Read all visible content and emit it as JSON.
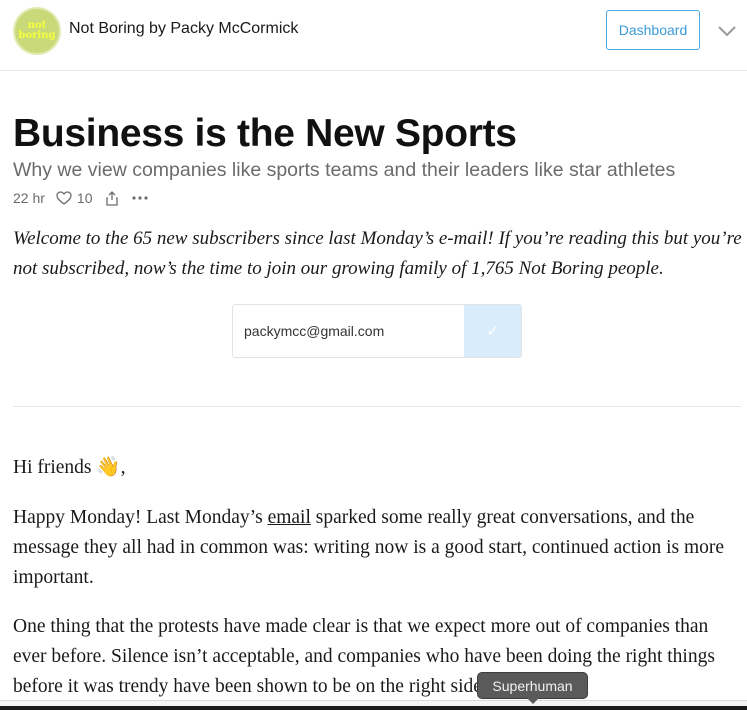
{
  "header": {
    "logo_text": [
      "not",
      "boring"
    ],
    "publication_name": "Not Boring by Packy McCormick",
    "dashboard_label": "Dashboard"
  },
  "post": {
    "title": "Business is the New Sports",
    "subtitle": "Why we view companies like sports teams and their leaders like star athletes",
    "time": "22 hr",
    "likes": "10",
    "more": "•••"
  },
  "intro": "Welcome to the 65 new subscribers since last Monday’s e-mail! If you’re reading this but you’re not subscribed, now’s the time to join our growing family of 1,765 Not Boring people.",
  "subscribe": {
    "email_value": "packymcc@gmail.com",
    "submit_label": "✓"
  },
  "body": {
    "greeting": "Hi friends 👋,",
    "p2_before": "Happy Monday! Last Monday’s ",
    "p2_link": "email",
    "p2_after": " sparked some really great conversations, and the message they all had in common was: writing now is a good start, continued action is more important.",
    "p3": "One thing that the protests have made clear is that we expect more out of companies than ever before. Silence isn’t acceptable, and companies who have been doing the right things before it was trendy have been shown to be on the right side of history."
  },
  "tooltip": {
    "label": "Superhuman"
  },
  "colors": {
    "accent": "#3a9ad9",
    "submit_bg": "#d9ecfb",
    "logo_bg": "#c9d97a",
    "logo_text": "#f5ff3a"
  }
}
